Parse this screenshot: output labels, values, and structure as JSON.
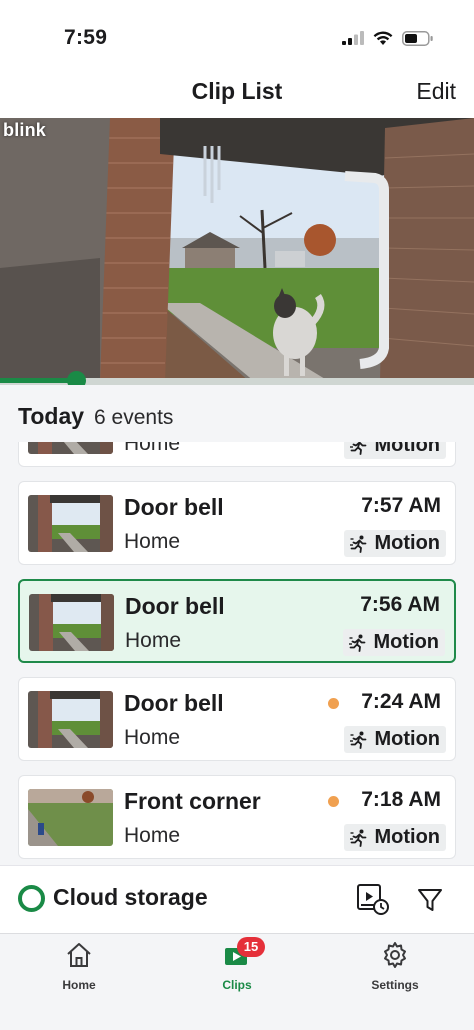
{
  "status_bar": {
    "time": "7:59",
    "icons": [
      "cellular-signal-icon",
      "wifi-icon",
      "battery-icon"
    ]
  },
  "header": {
    "title": "Clip List",
    "edit_label": "Edit"
  },
  "player": {
    "watermark": "blink",
    "progress": 0.16,
    "accent_color": "#1a8a46"
  },
  "list": {
    "day_label": "Today",
    "event_count": "6 events",
    "clips": [
      {
        "camera": "",
        "location": "Home",
        "time": "",
        "event_type": "Motion",
        "unread": false,
        "selected": false,
        "thumb": "doorbell"
      },
      {
        "camera": "Door bell",
        "location": "Home",
        "time": "7:57 AM",
        "event_type": "Motion",
        "unread": false,
        "selected": false,
        "thumb": "doorbell"
      },
      {
        "camera": "Door bell",
        "location": "Home",
        "time": "7:56 AM",
        "event_type": "Motion",
        "unread": false,
        "selected": true,
        "thumb": "doorbell"
      },
      {
        "camera": "Door bell",
        "location": "Home",
        "time": "7:24 AM",
        "event_type": "Motion",
        "unread": true,
        "selected": false,
        "thumb": "doorbell"
      },
      {
        "camera": "Front corner",
        "location": "Home",
        "time": "7:18 AM",
        "event_type": "Motion",
        "unread": true,
        "selected": false,
        "thumb": "front-corner"
      }
    ]
  },
  "cloud": {
    "label": "Cloud storage",
    "ring_color": "#1a8a46"
  },
  "tabs": [
    {
      "label": "Home",
      "icon": "house-icon",
      "active": false
    },
    {
      "label": "Clips",
      "icon": "play-clips-icon",
      "active": true,
      "badge": "15"
    },
    {
      "label": "Settings",
      "icon": "gear-icon",
      "active": false
    }
  ],
  "colors": {
    "selected_bg": "#e6f6ec",
    "selected_border": "#1f8a4a",
    "unread_dot": "#f0a050",
    "badge": "#e5303a"
  }
}
